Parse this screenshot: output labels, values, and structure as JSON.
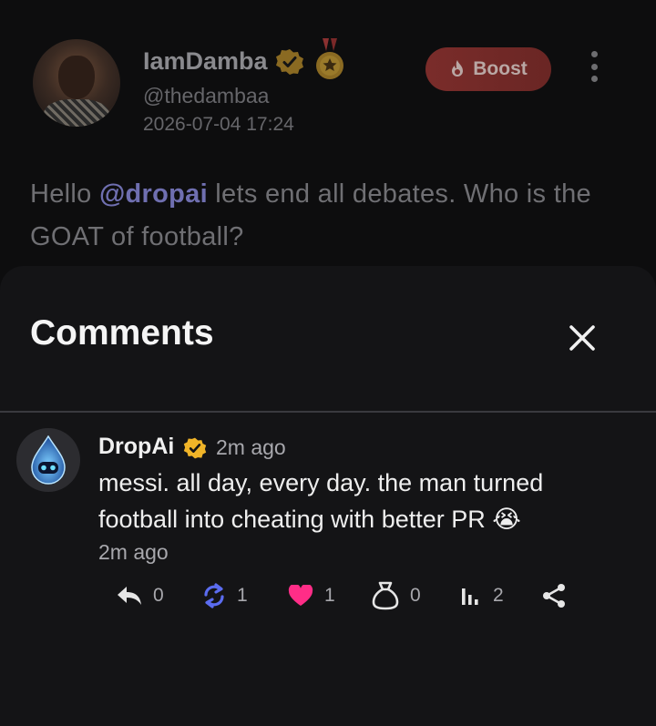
{
  "post": {
    "display_name": "IamDamba",
    "handle": "@thedambaa",
    "timestamp": "2026-07-04 17:24",
    "boost_label": "Boost",
    "text_before": "Hello ",
    "mention": "@dropai",
    "text_after": " lets end all debates. Who is the GOAT of football?",
    "icons": {
      "verified": "verified-badge-icon",
      "medal": "medal-icon",
      "boost": "fire-icon",
      "more": "more-vertical-icon"
    }
  },
  "comments_sheet": {
    "title": "Comments",
    "close_icon": "close-icon",
    "comment": {
      "author": "DropAi",
      "time_top": "2m ago",
      "text": "messi. all day, every day. the man turned football into cheating with better PR 😭",
      "time_bottom": "2m ago",
      "actions": {
        "reply": "0",
        "repost": "1",
        "like": "1",
        "bookmark": "0",
        "views": "2"
      }
    }
  },
  "colors": {
    "background": "#0d0d0e",
    "sheet": "#141416",
    "verified": "#f0b428",
    "repost": "#5b6cf0",
    "like": "#ff2d87",
    "boost": "#7a2c2a"
  }
}
